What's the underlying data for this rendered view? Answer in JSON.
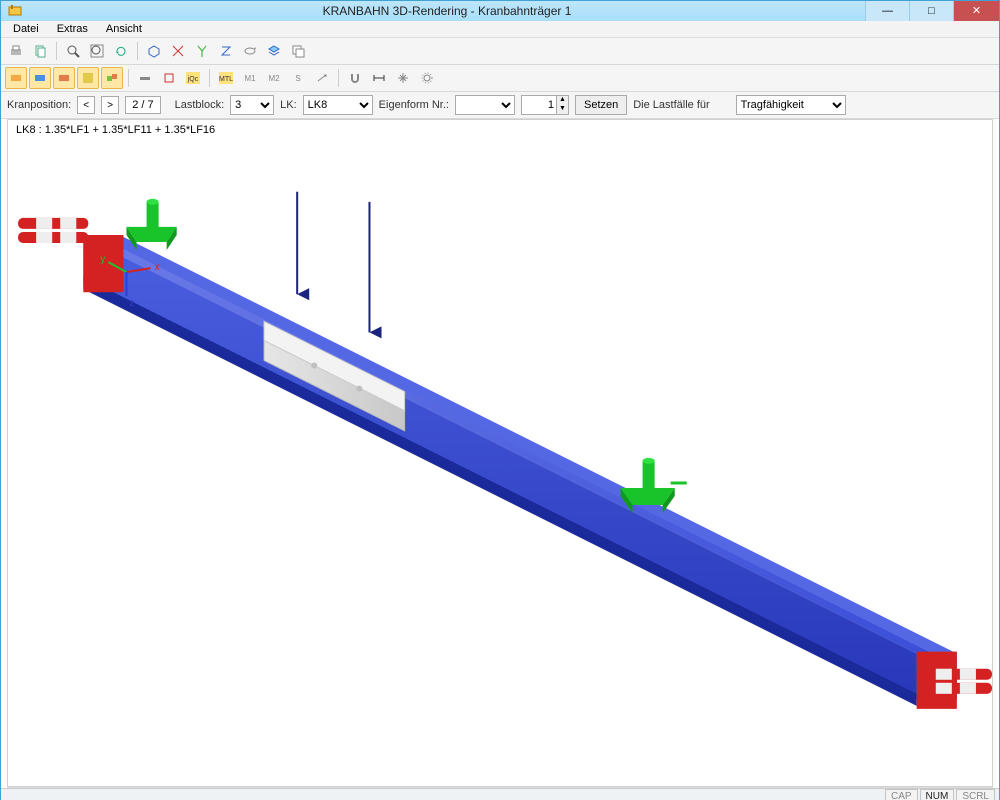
{
  "window": {
    "title": "KRANBAHN 3D-Rendering - Kranbahnträger 1"
  },
  "menu": {
    "datei": "Datei",
    "extras": "Extras",
    "ansicht": "Ansicht"
  },
  "controls": {
    "kranposition_label": "Kranposition:",
    "prev": "<",
    "next": ">",
    "position_value": "2 / 7",
    "lastblock_label": "Lastblock:",
    "lastblock_value": "3",
    "lk_label": "LK:",
    "lk_value": "LK8",
    "eigenform_label": "Eigenform Nr.:",
    "eigenform_value": "1",
    "setzen": "Setzen",
    "lastfalle_text": "Die Lastfälle für",
    "tragfahigkeit": "Tragfähigkeit"
  },
  "overlay": {
    "lk_formula": "LK8 : 1.35*LF1 + 1.35*LF11 + 1.35*LF16"
  },
  "axes": {
    "x": "x",
    "y": "y",
    "z": "z"
  },
  "status": {
    "cap": "CAP",
    "num": "NUM",
    "scrl": "SCRL"
  }
}
